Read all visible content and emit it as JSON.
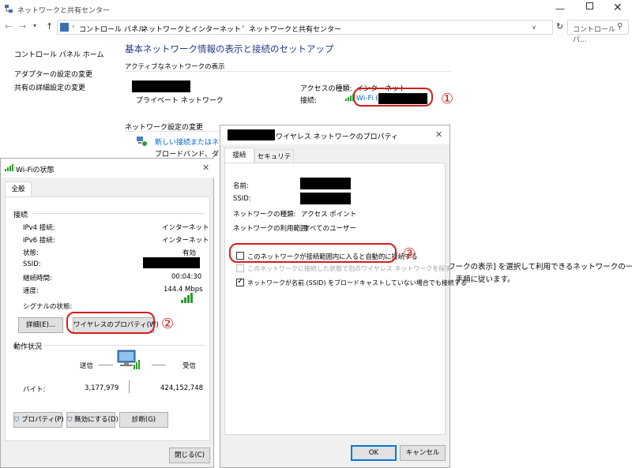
{
  "main_window": {
    "title": "ネットワークと共有センター",
    "address": {
      "crumbs": [
        "コントロール パネル",
        "ネットワークとインターネット",
        "ネットワークと共有センター"
      ],
      "search_placeholder": "コントロール パ..."
    },
    "sidebar": {
      "items": [
        "コントロール パネル ホーム",
        "アダプターの設定の変更",
        "共有の詳細設定の変更"
      ]
    },
    "page_title": "基本ネットワーク情報の表示と接続のセットアップ",
    "active_section": "アクティブなネットワークの表示",
    "network_type": "プライベート ネットワーク",
    "access_type_label": "アクセスの種類:",
    "access_type_value": "インターネット",
    "connection_label": "接続:",
    "connection_value": "Wi-Fi (",
    "change_section": "ネットワーク設定の変更",
    "new_connection_link": "新しい接続またはネットワ",
    "new_connection_desc": "ブロードバンド、ダイヤル",
    "trouble_text_1": "ワークの表示] を選択して利用できるネットワークの一",
    "trouble_text_2": "、手順に従います。"
  },
  "annotations": {
    "one": "①",
    "two": "②",
    "three": "③"
  },
  "wifi_status": {
    "title": "Wi-Fiの状態",
    "tab": "全般",
    "connection_section": "接続",
    "rows": [
      {
        "label": "IPv4 接続:",
        "value": "インターネット"
      },
      {
        "label": "IPv6 接続:",
        "value": "インターネット"
      },
      {
        "label": "状態:",
        "value": "有効"
      },
      {
        "label": "SSID:",
        "value": ""
      },
      {
        "label": "継続時間:",
        "value": "00:04:30"
      },
      {
        "label": "速度:",
        "value": "144.4 Mbps"
      }
    ],
    "signal_label": "シグナルの状態:",
    "details_button": "詳細(E)...",
    "wireless_props_button": "ワイヤレスのプロパティ(W)",
    "activity_section": "動作状況",
    "sent_label": "送信",
    "received_label": "受信",
    "bytes_label": "バイト:",
    "bytes_sent": "3,177,979",
    "bytes_received": "424,152,748",
    "properties_button": "プロパティ(P)",
    "disable_button": "無効にする(D)",
    "diagnose_button": "診断(G)",
    "close_button": "閉じる(C)"
  },
  "wireless_props": {
    "title": "ワイヤレス ネットワークのプロパティ",
    "tabs": [
      "接続",
      "セキュリティ"
    ],
    "name_label": "名前:",
    "ssid_label": "SSID:",
    "type_label": "ネットワークの種類:",
    "type_value": "アクセス ポイント",
    "scope_label": "ネットワークの利用範囲:",
    "scope_value": "すべてのユーザー",
    "options": [
      {
        "label": "このネットワークが接続範囲内に入ると自動的に接続する",
        "checked": false,
        "enabled": true
      },
      {
        "label": "このネットワークに接続した状態で別のワイヤレス ネットワークを探す",
        "checked": false,
        "enabled": false
      },
      {
        "label": "ネットワークが名前 (SSID) をブロードキャストしていない場合でも接続する",
        "checked": true,
        "enabled": true
      }
    ],
    "ok_button": "OK",
    "cancel_button": "キャンセル"
  },
  "colors": {
    "accent_red": "#d21e1e",
    "link_blue": "#0066cc",
    "title_blue": "#1e3a8a",
    "signal_green": "#2a9d2a"
  }
}
